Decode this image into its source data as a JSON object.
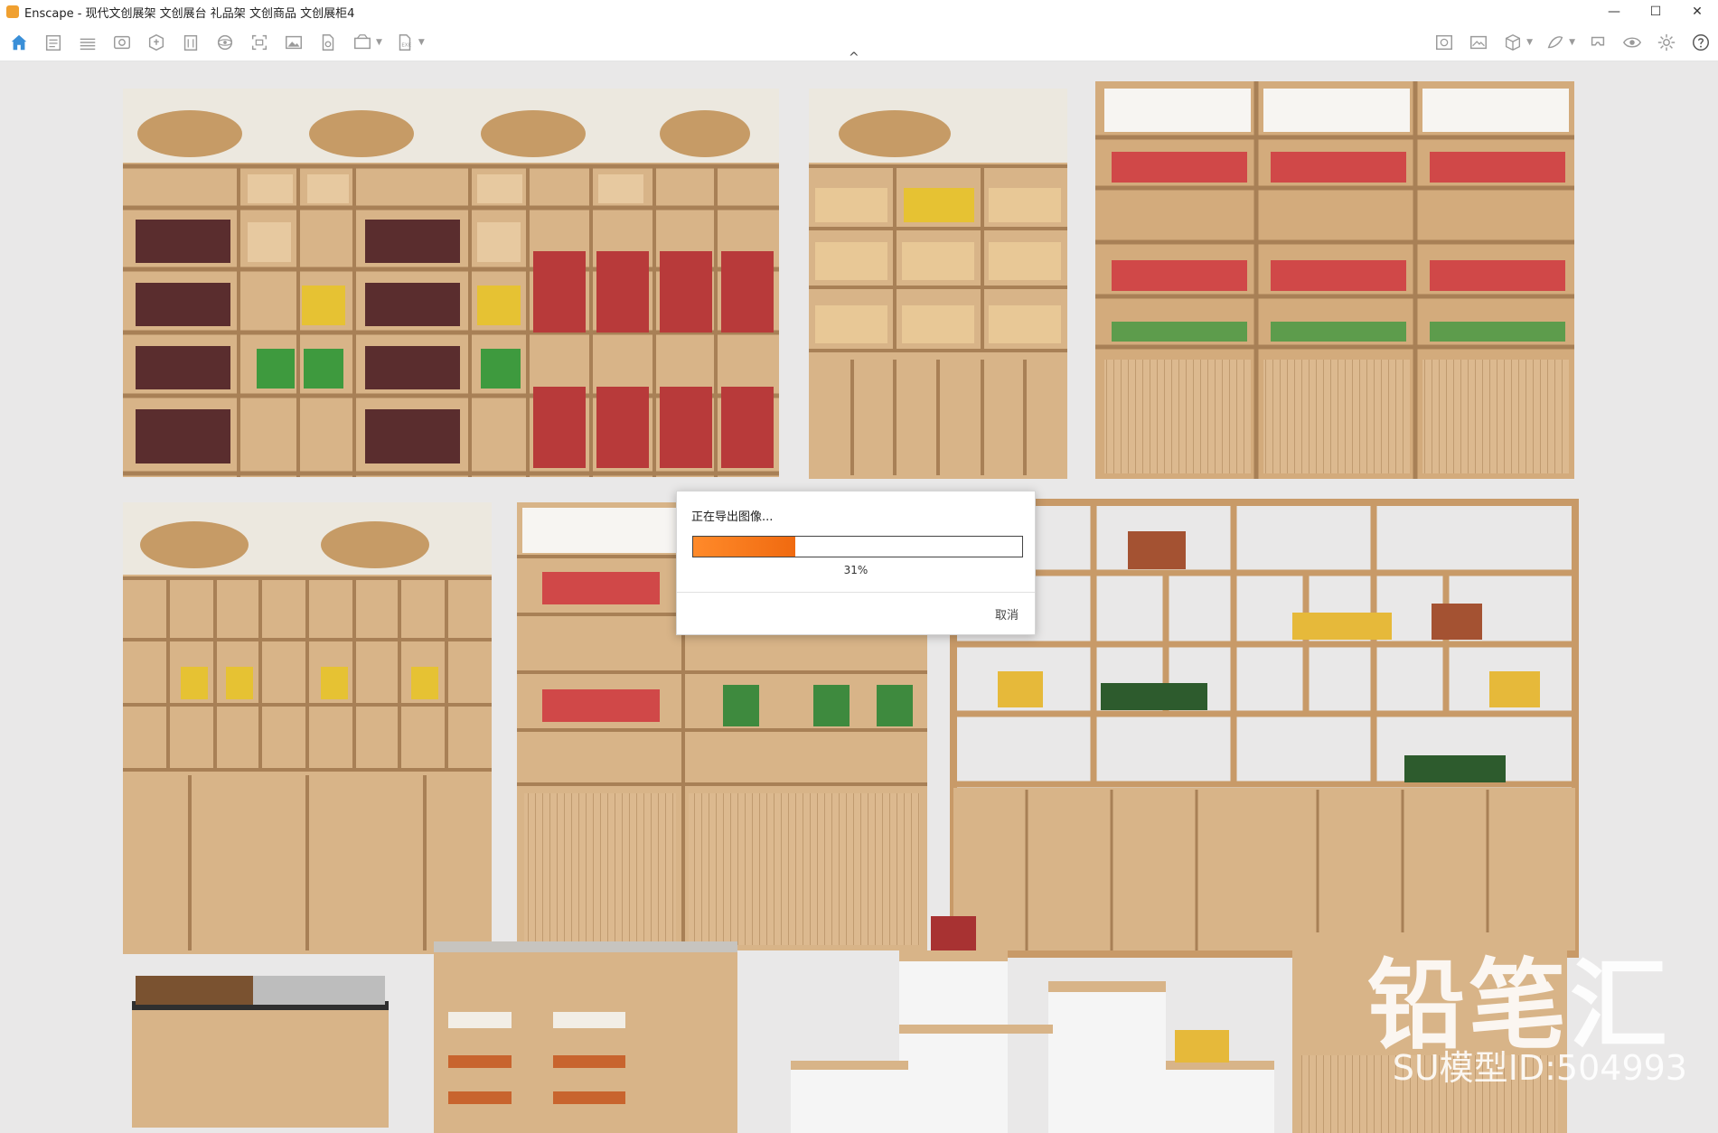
{
  "window": {
    "title": "Enscape - 现代文创展架 文创展台 礼品架 文创商品 文创展柜4",
    "minimize": "—",
    "maximize": "☐",
    "close": "✕"
  },
  "toolbar": {
    "left_icons": [
      "home-icon",
      "document-icon",
      "bim-icon",
      "visual-settings-icon",
      "asset-library-icon",
      "building-icon",
      "sphere-icon",
      "capture-icon",
      "image-icon",
      "export-icon",
      "batch-render-icon",
      "exe-export-icon"
    ],
    "right_icons": [
      "material-editor-icon",
      "screenshot-icon",
      "cube-view-icon",
      "feedback-icon",
      "vr-headset-icon",
      "eye-icon",
      "settings-icon",
      "help-icon"
    ],
    "collapse": "^"
  },
  "dialog": {
    "title": "正在导出图像...",
    "progress": 0.31,
    "percent_text": "31%",
    "cancel_label": "取消"
  },
  "watermark": {
    "brand": "铅笔汇",
    "model_id": "SU模型ID:504993"
  },
  "colors": {
    "accent": "#3a8fd8",
    "progress": "#f27a1e",
    "wood": "#d9b48a",
    "background": "#e9e8e8"
  }
}
